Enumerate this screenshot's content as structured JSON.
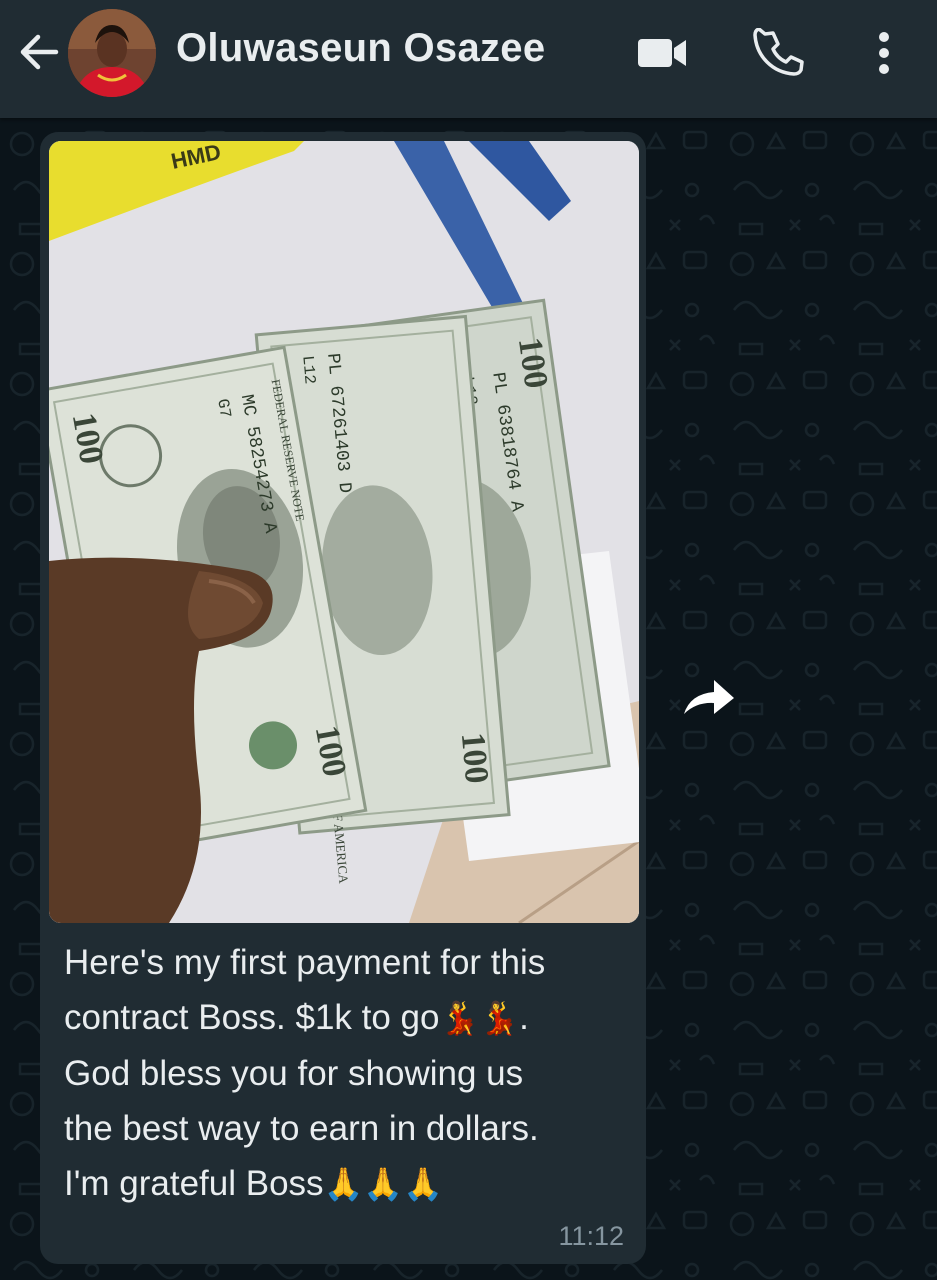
{
  "header": {
    "contact_name": "Oluwaseun Osazee",
    "icons": {
      "back": "arrow-left-icon",
      "video": "video-call-icon",
      "call": "phone-icon",
      "menu": "more-vert-icon"
    }
  },
  "message": {
    "caption": "Here's my first payment for this\ncontract Boss. $1k to go",
    "caption_emoji_1": "💃💃",
    "caption_after_emoji": ".\nGod bless you for showing us\nthe best way to earn in dollars.\nI'm grateful Boss",
    "caption_emoji_2": "🙏🙏🙏",
    "time": "11:12",
    "photo": {
      "box_label": "HMD",
      "notes": [
        {
          "serial": "MC 58254273 A",
          "sub": "G7",
          "denomination": "100"
        },
        {
          "serial": "PL 67261403 D",
          "sub": "L12",
          "denomination": "100"
        },
        {
          "serial": "PL 63818764 A",
          "sub": "L12",
          "denomination": "100"
        }
      ],
      "note_header": "FEDERAL RESERVE NOTE",
      "note_footer": "UNITED STATES OF AMERICA"
    }
  },
  "colors": {
    "background": "#0b141a",
    "header": "#202c33",
    "bubble": "#202c33",
    "text_primary": "#e9edef",
    "text_secondary": "#8696a0"
  }
}
